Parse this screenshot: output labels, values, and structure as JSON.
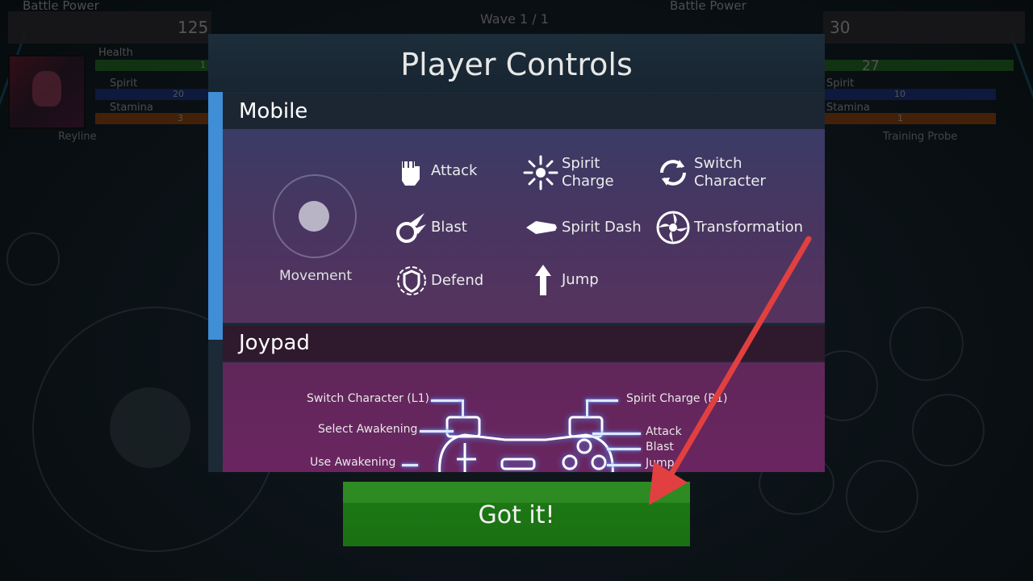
{
  "hud": {
    "left_battle_power_label": "Battle Power",
    "left_battle_power": "125",
    "wave": "Wave 1 / 1",
    "right_battle_power_label": "Battle Power",
    "right_battle_power": "30",
    "left": {
      "health_label": "Health",
      "health_value": "1",
      "spirit_label": "Spirit",
      "spirit_value": "20",
      "stamina_label": "Stamina",
      "stamina_value": "3",
      "name": "Reyline"
    },
    "right": {
      "health_value": "27",
      "spirit_label": "Spirit",
      "spirit_value": "10",
      "stamina_label": "Stamina",
      "stamina_value": "1",
      "name": "Training Probe"
    }
  },
  "modal": {
    "title": "Player Controls",
    "mobile": {
      "heading": "Mobile",
      "movement_label": "Movement",
      "controls": [
        {
          "label": "Attack",
          "icon": "fist-icon"
        },
        {
          "label": "Spirit\nCharge",
          "icon": "spirit-charge-icon"
        },
        {
          "label": "Switch\nCharacter",
          "icon": "switch-character-icon"
        },
        {
          "label": "Blast",
          "icon": "blast-icon"
        },
        {
          "label": "Spirit Dash",
          "icon": "spirit-dash-icon"
        },
        {
          "label": "Transformation",
          "icon": "transformation-icon"
        },
        {
          "label": "Defend",
          "icon": "shield-icon"
        },
        {
          "label": "Jump",
          "icon": "arrow-up-icon"
        }
      ]
    },
    "joypad": {
      "heading": "Joypad",
      "left_labels": [
        "Switch Character (L1)",
        "Select Awakening",
        "Use Awakening"
      ],
      "right_labels": [
        "Spirit Charge (R1)",
        "Attack",
        "Blast",
        "Jump"
      ]
    }
  },
  "button": {
    "label": "Got it!"
  },
  "colors": {
    "accent": "#3f8ed6",
    "button": "#1d7714",
    "annotation_arrow": "#e24040"
  }
}
